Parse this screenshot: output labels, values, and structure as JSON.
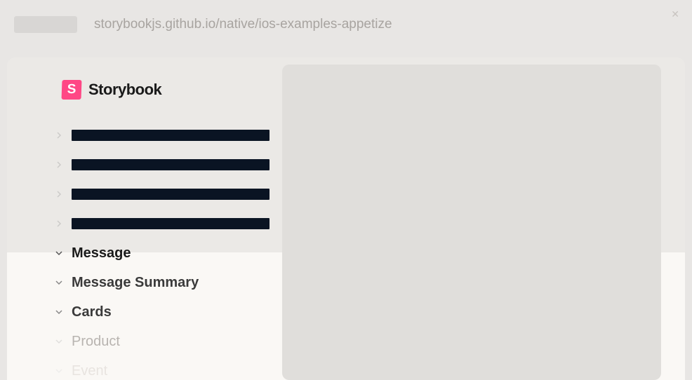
{
  "browser": {
    "url": "storybookjs.github.io/native/ios-examples-appetize"
  },
  "brand": {
    "name": "Storybook",
    "logo_letter": "S"
  },
  "sidebar": {
    "items": [
      {
        "label": "",
        "redacted": true
      },
      {
        "label": "",
        "redacted": true
      },
      {
        "label": "",
        "redacted": true
      },
      {
        "label": "",
        "redacted": true
      },
      {
        "label": "Message",
        "active": true
      },
      {
        "label": "Message Summary"
      },
      {
        "label": "Cards"
      },
      {
        "label": "Product",
        "faded": true
      },
      {
        "label": "Event",
        "very_faded": true
      }
    ]
  },
  "colors": {
    "brand_pink": "#ff4785",
    "text_dark": "#1a1a1a",
    "redacted_dark": "#0a1423"
  }
}
